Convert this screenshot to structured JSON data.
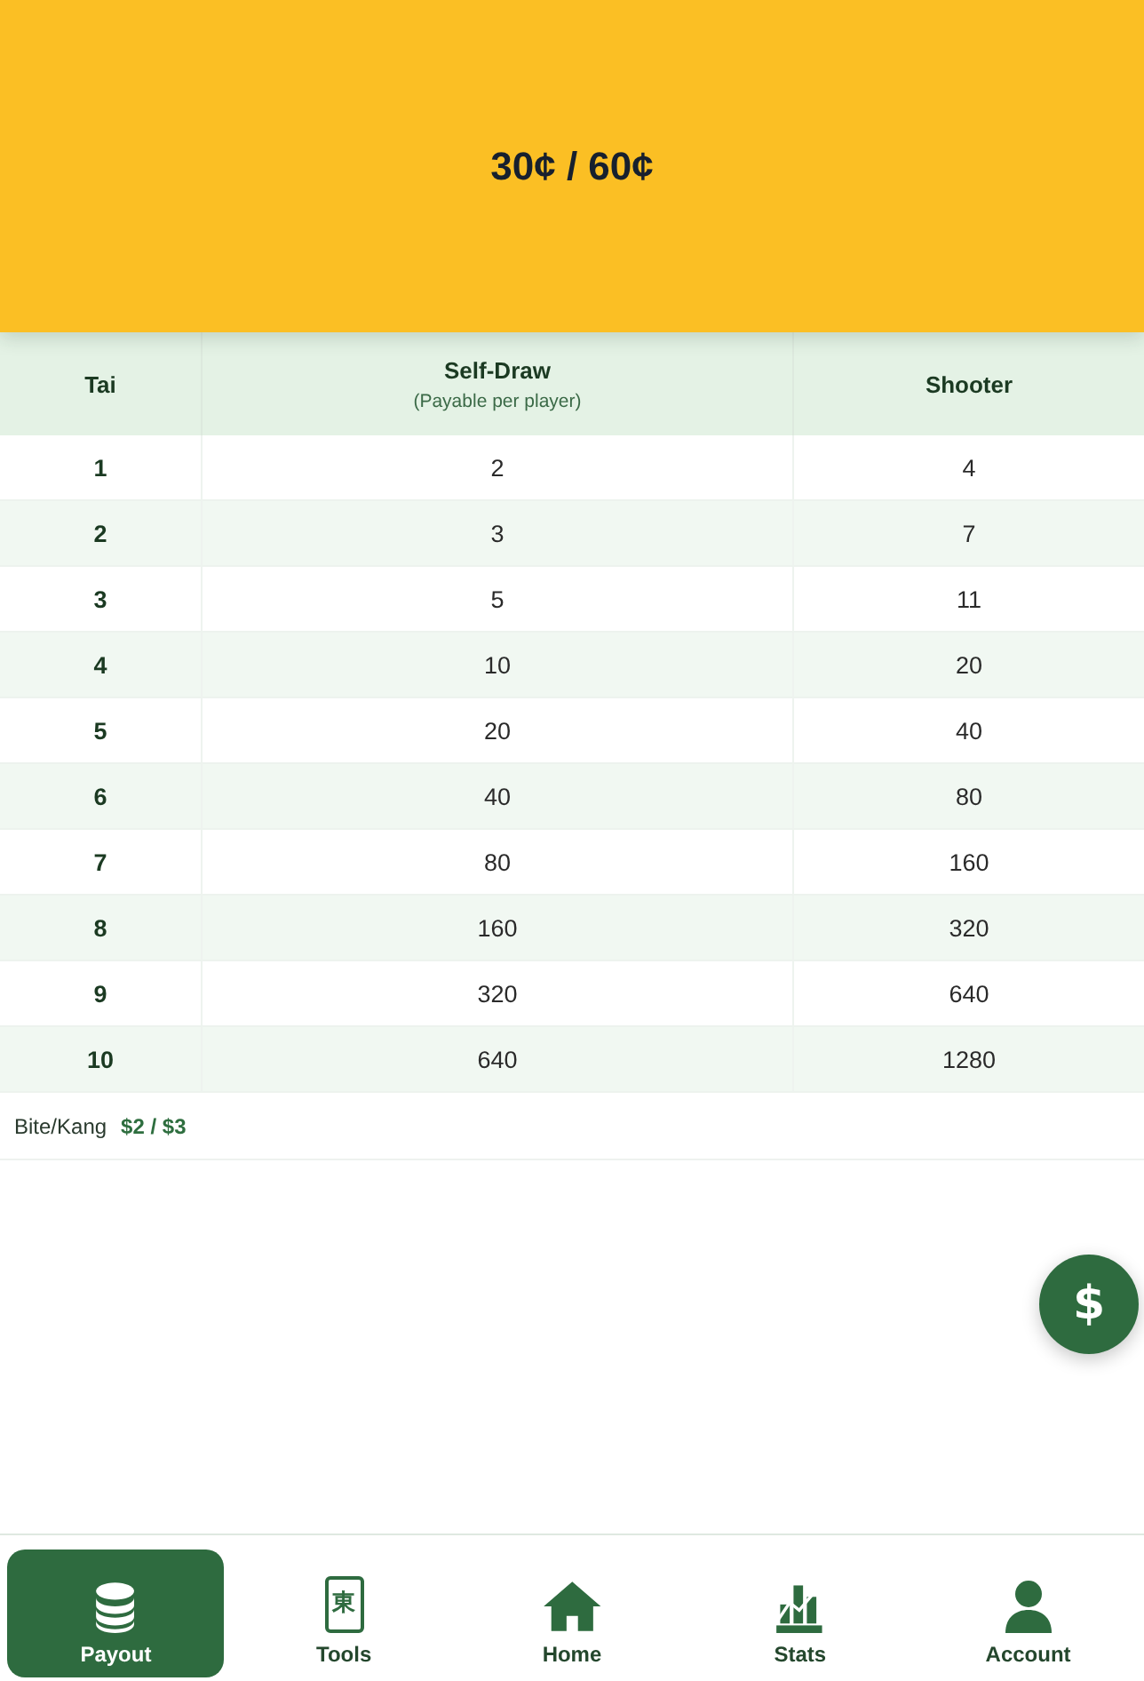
{
  "header": {
    "title": "30¢ / 60¢"
  },
  "table": {
    "columns": [
      {
        "label": "Tai"
      },
      {
        "label": "Self-Draw",
        "note": "(Payable per player)"
      },
      {
        "label": "Shooter"
      }
    ],
    "rows": [
      {
        "tai": "1",
        "self_draw": "2",
        "shooter": "4"
      },
      {
        "tai": "2",
        "self_draw": "3",
        "shooter": "7"
      },
      {
        "tai": "3",
        "self_draw": "5",
        "shooter": "11"
      },
      {
        "tai": "4",
        "self_draw": "10",
        "shooter": "20"
      },
      {
        "tai": "5",
        "self_draw": "20",
        "shooter": "40"
      },
      {
        "tai": "6",
        "self_draw": "40",
        "shooter": "80"
      },
      {
        "tai": "7",
        "self_draw": "80",
        "shooter": "160"
      },
      {
        "tai": "8",
        "self_draw": "160",
        "shooter": "320"
      },
      {
        "tai": "9",
        "self_draw": "320",
        "shooter": "640"
      },
      {
        "tai": "10",
        "self_draw": "640",
        "shooter": "1280"
      }
    ]
  },
  "bite_kang": {
    "label": "Bite/Kang",
    "value": "$2 / $3"
  },
  "fab": {
    "symbol": "$"
  },
  "nav": [
    {
      "label": "Payout",
      "selected": true
    },
    {
      "label": "Tools",
      "selected": false,
      "tile_text": "東"
    },
    {
      "label": "Home",
      "selected": false
    },
    {
      "label": "Stats",
      "selected": false
    },
    {
      "label": "Account",
      "selected": false
    }
  ]
}
